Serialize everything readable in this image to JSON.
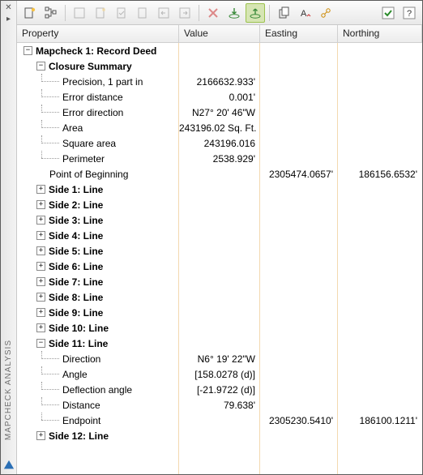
{
  "panel_title": "MAPCHECK ANALYSIS",
  "columns": {
    "property": "Property",
    "value": "Value",
    "easting": "Easting",
    "northing": "Northing"
  },
  "root_label": "Mapcheck 1: Record Deed",
  "closure": {
    "label": "Closure Summary",
    "precision_label": "Precision, 1 part in",
    "precision_value": "2166632.933'",
    "errdist_label": "Error distance",
    "errdist_value": "0.001'",
    "errdir_label": "Error direction",
    "errdir_value": "N27° 20' 46\"W",
    "area_label": "Area",
    "area_value": "243196.02 Sq. Ft.",
    "sqarea_label": "Square area",
    "sqarea_value": "243196.016",
    "perim_label": "Perimeter",
    "perim_value": "2538.929'"
  },
  "pob": {
    "label": "Point of Beginning",
    "easting": "2305474.0657'",
    "northing": "186156.6532'"
  },
  "sides": {
    "s1": "Side 1: Line",
    "s2": "Side 2: Line",
    "s3": "Side 3: Line",
    "s4": "Side 4: Line",
    "s5": "Side 5: Line",
    "s6": "Side 6: Line",
    "s7": "Side 7: Line",
    "s8": "Side 8: Line",
    "s9": "Side 9: Line",
    "s10": "Side 10: Line",
    "s12": "Side 12: Line"
  },
  "side11": {
    "label": "Side 11: Line",
    "dir_label": "Direction",
    "dir_value": "N6° 19' 22\"W",
    "ang_label": "Angle",
    "ang_value": "[158.0278 (d)]",
    "def_label": "Deflection angle",
    "def_value": "[-21.9722 (d)]",
    "dist_label": "Distance",
    "dist_value": "79.638'",
    "end_label": "Endpoint",
    "end_east": "2305230.5410'",
    "end_north": "186100.1211'"
  }
}
